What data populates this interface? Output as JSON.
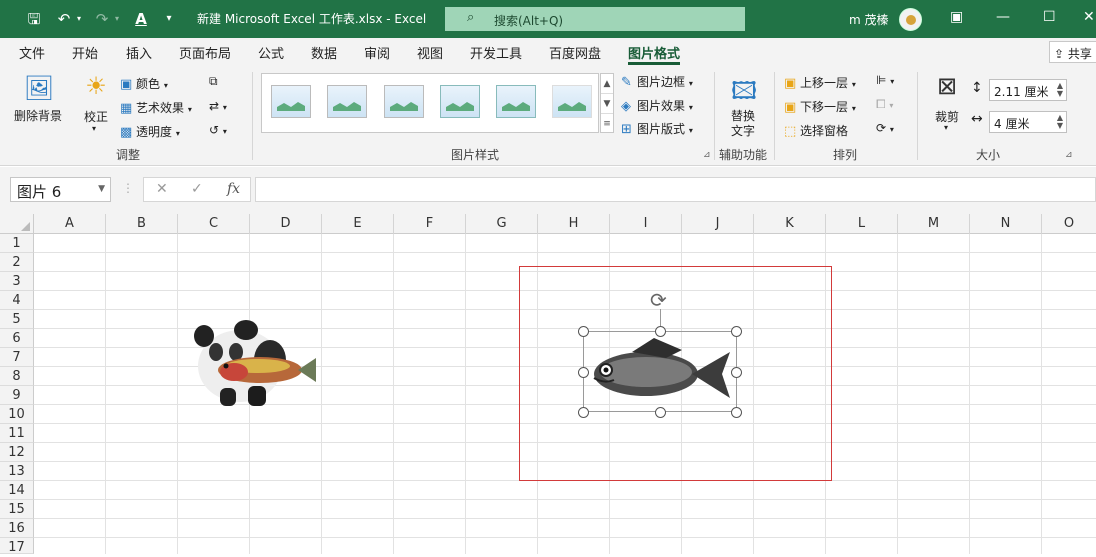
{
  "titlebar": {
    "title": "新建 Microsoft Excel 工作表.xlsx  -  Excel",
    "search_placeholder": "搜索(Alt+Q)",
    "user": "m 茂榛",
    "bg": "#217346"
  },
  "tabs": [
    "文件",
    "开始",
    "插入",
    "页面布局",
    "公式",
    "数据",
    "审阅",
    "视图",
    "开发工具",
    "百度网盘",
    "图片格式"
  ],
  "active_tab": "图片格式",
  "share_label": "共享",
  "ribbon": {
    "adjust": {
      "remove_bg": "删除背景",
      "correct": "校正",
      "color": "颜色",
      "artistic": "艺术效果",
      "transparency": "透明度",
      "label": "调整"
    },
    "styles": {
      "border": "图片边框",
      "effects": "图片效果",
      "layout": "图片版式",
      "label": "图片样式"
    },
    "accessibility": {
      "alt_text_1": "替换",
      "alt_text_2": "文字",
      "label": "辅助功能"
    },
    "arrange": {
      "forward": "上移一层",
      "backward": "下移一层",
      "selection_pane": "选择窗格",
      "label": "排列"
    },
    "size": {
      "crop": "裁剪",
      "height": "2.11 厘米",
      "width": "4 厘米",
      "label": "大小"
    }
  },
  "formula": {
    "name_box": "图片 6",
    "cancel": "✕",
    "enter": "✓",
    "fx": "fx",
    "value": ""
  },
  "columns": [
    "A",
    "B",
    "C",
    "D",
    "E",
    "F",
    "G",
    "H",
    "I",
    "J",
    "K",
    "L",
    "M",
    "N",
    "O"
  ],
  "rows": [
    "1",
    "2",
    "3",
    "4",
    "5",
    "6",
    "7",
    "8",
    "9",
    "10",
    "11",
    "12",
    "13",
    "14",
    "15",
    "16",
    "17"
  ],
  "accent": "#185c37"
}
